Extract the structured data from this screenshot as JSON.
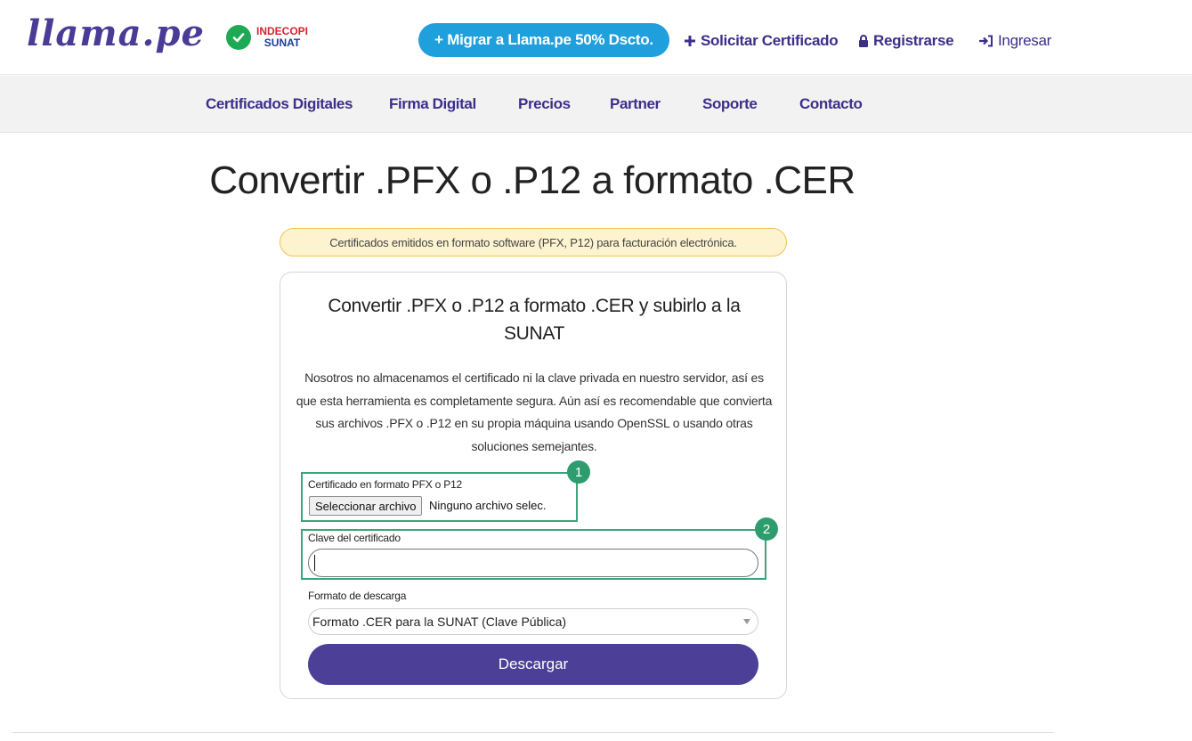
{
  "header": {
    "logo": "llama.pe",
    "badge": {
      "line1": "INDECOPI",
      "line2": "SUNAT"
    },
    "migrate_button": "+ Migrar a Llama.pe 50% Dscto.",
    "request_link": "Solicitar Certificado",
    "register_link": "Registrarse",
    "login_link": "Ingresar"
  },
  "nav": {
    "items": [
      "Certificados Digitales",
      "Firma Digital",
      "Precios",
      "Partner",
      "Soporte",
      "Contacto"
    ]
  },
  "main": {
    "title": "Convertir .PFX o .P12 a formato .CER",
    "notice": "Certificados emitidos en formato software (PFX, P12) para facturación electrónica.",
    "card": {
      "title_line1": "Convertir .PFX o .P12 a formato .CER y subirlo a la",
      "title_line2": "SUNAT",
      "description": [
        "Nosotros no almacenamos el certificado ni la clave privada en nuestro servidor, así es",
        "que esta herramienta es completamente segura. Aún así es recomendable que convierta",
        "sus archivos .PFX o .P12 en su propia máquina usando OpenSSL o usando otras",
        "soluciones semejantes."
      ],
      "file_label": "Certificado en formato PFX o P12",
      "file_button": "Seleccionar archivo",
      "file_status": "Ninguno archivo selec.",
      "password_label": "Clave del certificado",
      "password_value": "",
      "format_label": "Formato de descarga",
      "format_selected": "Formato .CER para la SUNAT (Clave Pública)",
      "download_button": "Descargar"
    },
    "annotations": [
      "1",
      "2"
    ]
  },
  "colors": {
    "brand": "#4a3b96",
    "accent_blue": "#1f9fdc",
    "button_purple": "#4b3f97",
    "highlight_green": "#3aa57a",
    "notice_bg": "#fdf3cf"
  }
}
